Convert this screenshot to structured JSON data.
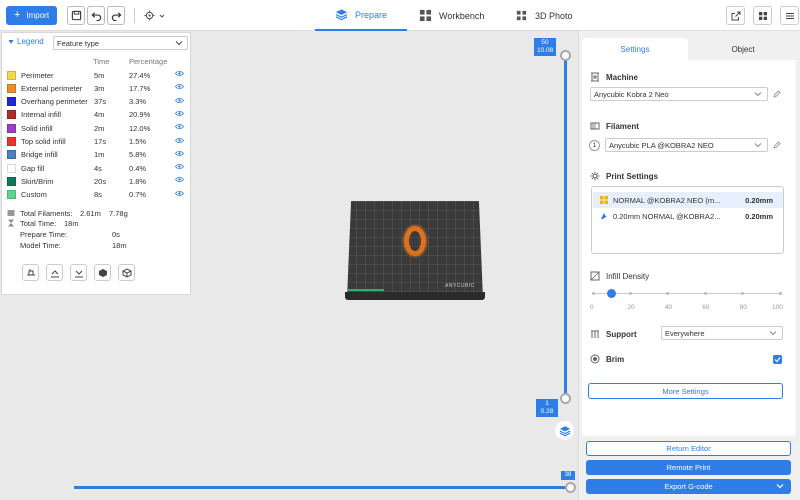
{
  "toolbar": {
    "import_label": "Import",
    "tabs": [
      {
        "label": "Prepare",
        "active": true
      },
      {
        "label": "Workbench",
        "active": false
      },
      {
        "label": "3D Photo",
        "active": false
      }
    ]
  },
  "legend": {
    "title": "Legend",
    "view_type": "Feature type",
    "col_time": "Time",
    "col_percentage": "Percentage",
    "rows": [
      {
        "name": "Perimeter",
        "time": "5m",
        "pct": "27.4%",
        "color": "#f5d847"
      },
      {
        "name": "External perimeter",
        "time": "3m",
        "pct": "17.7%",
        "color": "#f08a2a"
      },
      {
        "name": "Overhang perimeter",
        "time": "37s",
        "pct": "3.3%",
        "color": "#2323d9"
      },
      {
        "name": "Internal infill",
        "time": "4m",
        "pct": "20.9%",
        "color": "#b22a2a"
      },
      {
        "name": "Solid infill",
        "time": "2m",
        "pct": "12.0%",
        "color": "#9a3ec9"
      },
      {
        "name": "Top solid infill",
        "time": "17s",
        "pct": "1.5%",
        "color": "#f03030"
      },
      {
        "name": "Bridge infill",
        "time": "1m",
        "pct": "5.8%",
        "color": "#4e7fbf"
      },
      {
        "name": "Gap fill",
        "time": "4s",
        "pct": "0.4%",
        "color": "#ffffff"
      },
      {
        "name": "Skirt/Brim",
        "time": "20s",
        "pct": "1.8%",
        "color": "#0e7a5a"
      },
      {
        "name": "Custom",
        "time": "8s",
        "pct": "0.7%",
        "color": "#5ad68a"
      }
    ],
    "stats": {
      "total_filaments_label": "Total Filaments:",
      "total_filaments_len": "2.61m",
      "total_filaments_weight": "7.78g",
      "total_time_label": "Total Time:",
      "total_time": "18m",
      "prepare_time_label": "Prepare Time:",
      "prepare_time": "0s",
      "model_time_label": "Model Time:",
      "model_time": "18m"
    }
  },
  "viewport": {
    "brand": "ANYCUBIC",
    "vslider_top_layer": "50",
    "vslider_top_height": "10.08",
    "vslider_bottom_layer": "1",
    "vslider_bottom_height": "0.28",
    "hslider_value": "38"
  },
  "panel": {
    "tab_settings": "Settings",
    "tab_object": "Object",
    "machine_title": "Machine",
    "machine_value": "Anycubic Kobra 2 Neo",
    "filament_title": "Filament",
    "filament_index": "1",
    "filament_value": "Anycubic PLA @KOBRA2 NEO",
    "print_settings_title": "Print Settings",
    "print_profiles": [
      {
        "name": "NORMAL @KOBRA2 NEO (m...",
        "value": "0.20mm"
      },
      {
        "name": "0.20mm NORMAL @KOBRA2...",
        "value": "0.20mm"
      }
    ],
    "infill_title": "Infill Density",
    "infill_value_pct": 10,
    "infill_ticks": [
      "0",
      "20",
      "40",
      "60",
      "80",
      "100"
    ],
    "support_title": "Support",
    "support_value": "Everywhere",
    "brim_title": "Brim",
    "brim_checked": true,
    "more_settings": "More Settings",
    "return_editor": "Return Editor",
    "remote_print": "Remote Print",
    "export_gcode": "Export G-code"
  },
  "colors": {
    "accent": "#2f7ee8"
  }
}
